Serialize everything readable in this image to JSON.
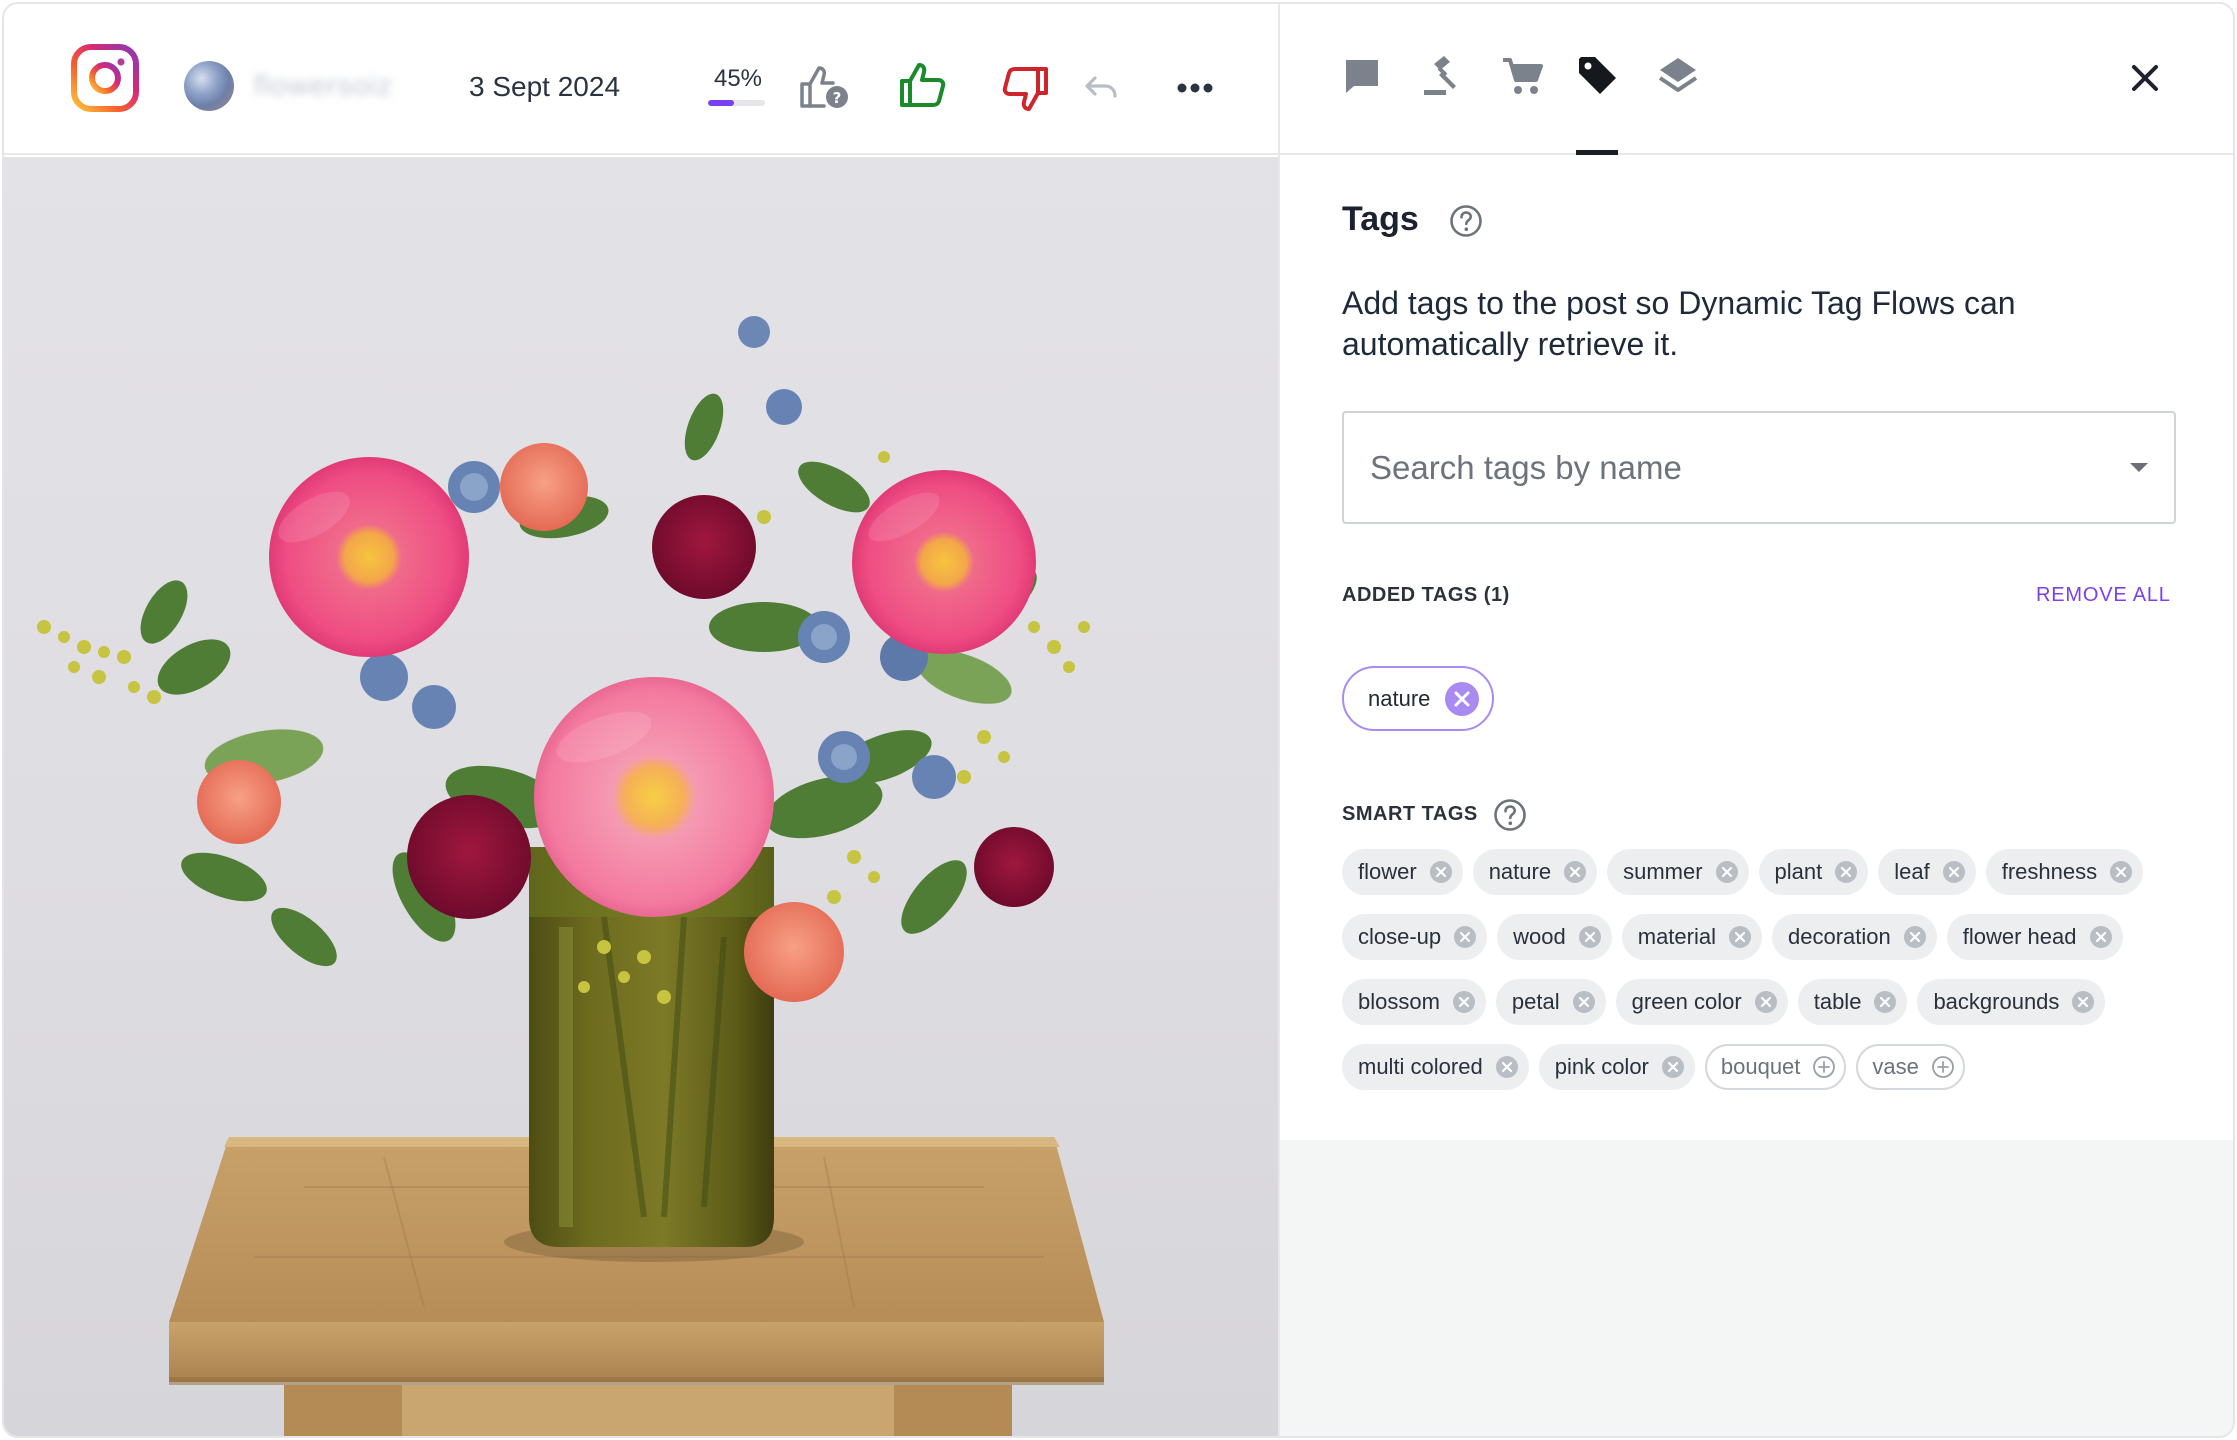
{
  "header": {
    "platform": "instagram-icon",
    "username": "flowersoiz",
    "date": "3 Sept 2024",
    "score": {
      "label": "45%",
      "value": 0.45,
      "color": "#7a3ff2"
    },
    "actions": [
      "thumb-question-icon",
      "thumb-up-icon",
      "thumb-down-icon",
      "undo-icon",
      "more-icon"
    ]
  },
  "tabs": [
    {
      "icon": "comment-icon"
    },
    {
      "icon": "gavel-icon"
    },
    {
      "icon": "cart-icon"
    },
    {
      "icon": "tag-icon",
      "active": true
    },
    {
      "icon": "layers-icon"
    }
  ],
  "panel": {
    "title": "Tags",
    "description": "Add tags to the post so Dynamic Tag Flows can automatically retrieve it.",
    "search": {
      "placeholder": "Search tags by name",
      "value": ""
    },
    "added_label": "ADDED TAGS (1)",
    "remove_all": "REMOVE ALL",
    "added_tags": [
      "nature"
    ],
    "smart_label": "SMART TAGS",
    "smart_tags": [
      {
        "label": "flower",
        "added": true
      },
      {
        "label": "nature",
        "added": true
      },
      {
        "label": "summer",
        "added": true
      },
      {
        "label": "plant",
        "added": true
      },
      {
        "label": "leaf",
        "added": true
      },
      {
        "label": "freshness",
        "added": true
      },
      {
        "label": "close-up",
        "added": true
      },
      {
        "label": "wood",
        "added": true
      },
      {
        "label": "material",
        "added": true
      },
      {
        "label": "decoration",
        "added": true
      },
      {
        "label": "flower head",
        "added": true
      },
      {
        "label": "blossom",
        "added": true
      },
      {
        "label": "petal",
        "added": true
      },
      {
        "label": "green color",
        "added": true
      },
      {
        "label": "table",
        "added": true
      },
      {
        "label": "backgrounds",
        "added": true
      },
      {
        "label": "multi colored",
        "added": true
      },
      {
        "label": "pink color",
        "added": true
      },
      {
        "label": "bouquet",
        "added": false
      },
      {
        "label": "vase",
        "added": false
      }
    ]
  },
  "colors": {
    "accent": "#7c3ff0",
    "like": "#1a8a2a",
    "dislike": "#d0242b"
  }
}
